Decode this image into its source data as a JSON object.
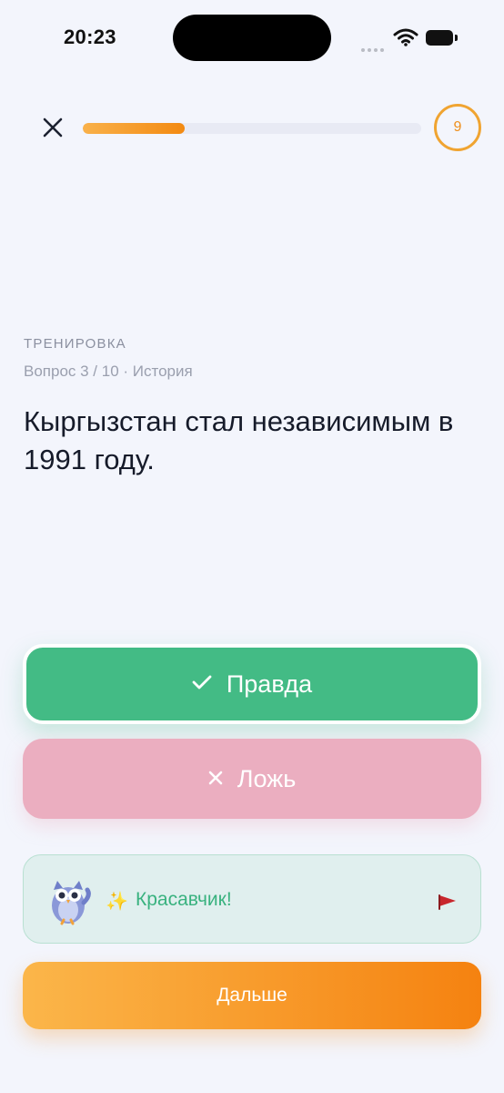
{
  "status_bar": {
    "time": "20:23"
  },
  "header": {
    "progress_fraction": 0.3,
    "timer_value": "9",
    "accent_color": "#f38a12"
  },
  "quiz": {
    "mode_label": "ТРЕНИРОВКА",
    "meta": "Вопрос 3 / 10 · История",
    "question": "Кыргызстан стал независимым в 1991 году."
  },
  "answers": {
    "true_label": "Правда",
    "false_label": "Ложь",
    "true_color": "#43bb85",
    "false_color": "#ebaec0"
  },
  "feedback": {
    "text": "Красавчик!",
    "icons": [
      "owl-mascot-icon",
      "sparkles-icon",
      "flag-icon"
    ]
  },
  "next_button": {
    "label": "Дальше"
  }
}
